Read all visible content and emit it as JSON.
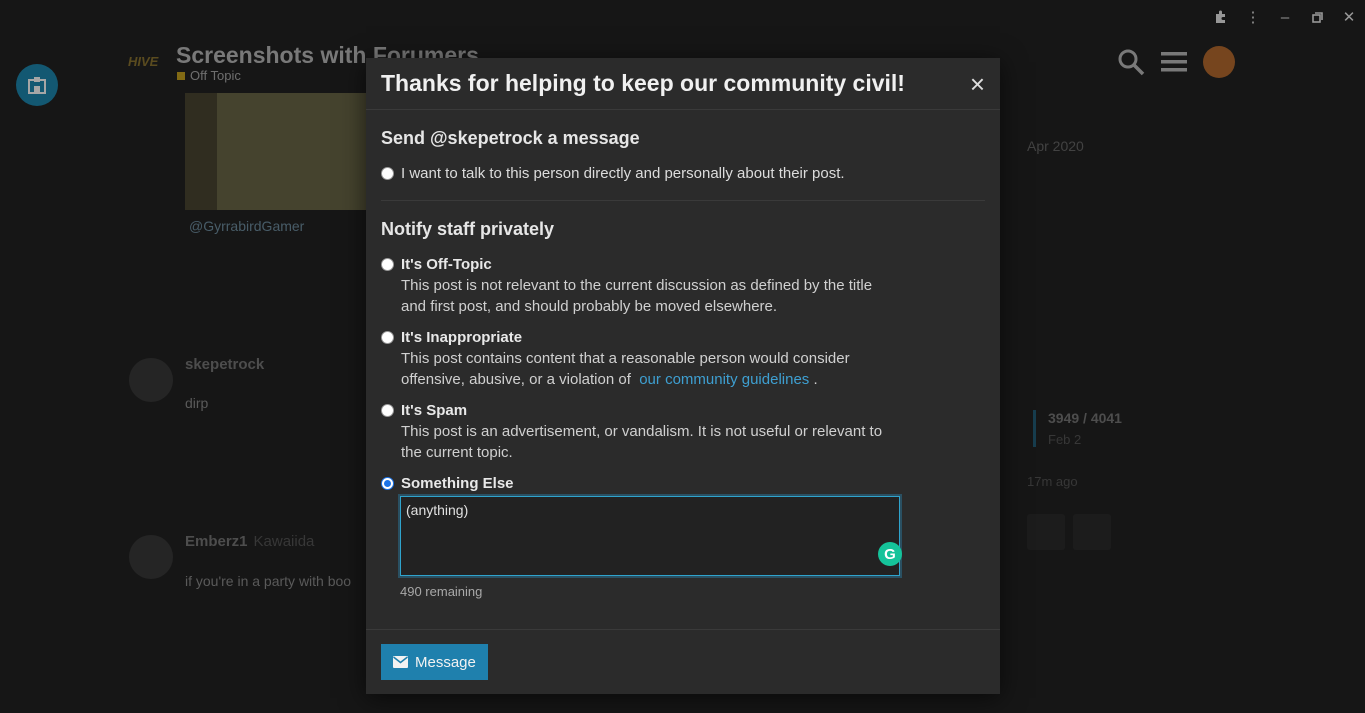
{
  "background": {
    "logo_text": "HIVE",
    "topic_title": "Screenshots with Forumers",
    "topic_category": "Off Topic",
    "mention": "@GyrrabirdGamer",
    "posts": [
      {
        "user": "skepetrock",
        "subtitle": "",
        "text": "dirp"
      },
      {
        "user": "Emberz1",
        "subtitle": "Kawaiida",
        "text": "if you're in a party with boo"
      }
    ],
    "timeline": {
      "date": "Apr 2020",
      "position": "3949 / 4041",
      "sub": "Feb 2",
      "ago": "17m ago"
    }
  },
  "modal": {
    "title": "Thanks for helping to keep our community civil!",
    "close_icon": "×",
    "message_section": {
      "heading": "Send @skepetrock a message",
      "option_label": "I want to talk to this person directly and personally about their post."
    },
    "staff_section": {
      "heading": "Notify staff privately",
      "options": [
        {
          "label": "It's Off-Topic",
          "desc": "This post is not relevant to the current discussion as defined by the title and first post, and should probably be moved elsewhere."
        },
        {
          "label": "It's Inappropriate",
          "desc": "This post contains content that a reasonable person would consider offensive, abusive, or a violation of",
          "link": "our community guidelines",
          "desc_end": "."
        },
        {
          "label": "It's Spam",
          "desc": "This post is an advertisement, or vandalism. It is not useful or relevant to the current topic."
        },
        {
          "label": "Something Else",
          "textarea_value": "(anything)",
          "remaining": "490 remaining"
        }
      ]
    },
    "footer": {
      "button_label": "Message"
    }
  },
  "colors": {
    "accent": "#1f80ad",
    "link": "#3e9fd1",
    "grammarly": "#15c39a"
  }
}
